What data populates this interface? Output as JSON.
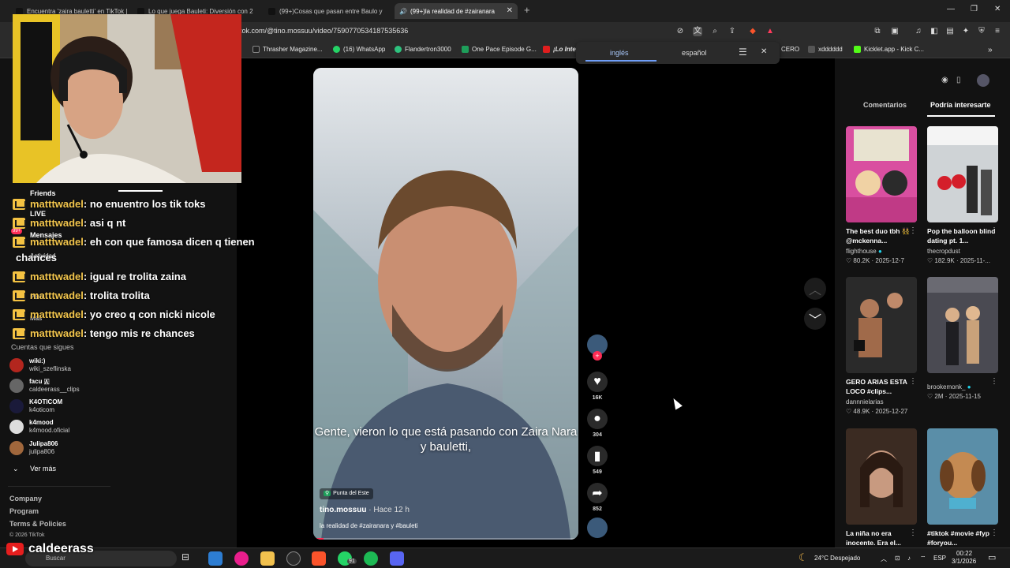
{
  "browser": {
    "tabs": [
      {
        "label": "Encuentra 'zaira bauletti' en TikTok |"
      },
      {
        "label": "Lo que juega Bauleti: Diversión con 2"
      },
      {
        "label": "(99+)Cosas que pasan entre Baulo y"
      },
      {
        "label": "(99+)la realidad de #zairanara"
      }
    ],
    "url": "tok.com/@tino.mossuu/video/7590770534187535636",
    "bookmarks": [
      {
        "label": "Thrasher Magazine...",
        "color": "#222"
      },
      {
        "label": "(16) WhatsApp",
        "color": "#25d366"
      },
      {
        "label": "Flandertron3000",
        "color": "#2ec27e"
      },
      {
        "label": "One Pace Episode G...",
        "color": "#1e9e5a"
      },
      {
        "label": "¡Lo Inte",
        "color": "#e01e1e"
      },
      {
        "label": "CERO",
        "color": "#444"
      },
      {
        "label": "xdddddd",
        "color": "#555"
      },
      {
        "label": "Kicklet.app - Kick C...",
        "color": "#53fc18"
      }
    ],
    "translate": {
      "source": "inglés",
      "target": "español"
    }
  },
  "sidebar": {
    "nav": {
      "friends": "Friends",
      "live": "LIVE",
      "messages": "Mensajes",
      "messages_badge": "99+",
      "activity": "Actividad",
      "profile": "Perfil",
      "more": "Más"
    },
    "following_title": "Cuentas que sigues",
    "following": [
      {
        "name": "wiki:)",
        "handle": "wiki_szeflinska",
        "color": "#b3261e"
      },
      {
        "name": "facu 🇦",
        "handle": "caldeerass__clips",
        "color": "#666"
      },
      {
        "name": "K4OTICOM",
        "handle": "k4oticom",
        "color": "#1a1a3a"
      },
      {
        "name": "k4mood",
        "handle": "k4mood.oficial",
        "color": "#ddd"
      },
      {
        "name": "Julipa806",
        "handle": "julipa806",
        "color": "#a0673c"
      }
    ],
    "see_more": "Ver más",
    "footer": [
      "Company",
      "Program",
      "Terms & Policies"
    ],
    "copyright": "© 2026 TikTok"
  },
  "chat": [
    {
      "user": "matttwadel",
      "text": ": no enuentro los tik toks"
    },
    {
      "user": "matttwadel",
      "text": ": asi q nt"
    },
    {
      "user": "matttwadel",
      "text": ": eh con que famosa dicen q tienen"
    },
    {
      "user": "",
      "text": "chances"
    },
    {
      "user": "matttwadel",
      "text": ": igual re trolita zaina"
    },
    {
      "user": "matttwadel",
      "text": ": trolita trolita"
    },
    {
      "user": "matttwadel",
      "text": ": yo creo q con nicki nicole"
    },
    {
      "user": "matttwadel",
      "text": ": tengo mis re chances"
    }
  ],
  "video": {
    "caption": "Gente, vieron lo que está pasando con Zaira Nara y bauletti,",
    "location": "Punta del Este",
    "author": "tino.mossuu",
    "time_ago": "· Hace 12 h",
    "description": "la realidad de #zairanara y #bauleti",
    "likes": "16K",
    "comments": "304",
    "saves": "549",
    "shares": "852"
  },
  "right_panel": {
    "tabs": {
      "comments": "Comentarios",
      "suggested": "Podría interesarte"
    },
    "cards": [
      {
        "title": "The best duo tbh 👯 @mckenna...",
        "user": "flighthouse",
        "likes": "80.2K",
        "date": "2025-12-7",
        "thumb": "#d94fa0"
      },
      {
        "title": "Pop the balloon blind dating pt. 1...",
        "user": "thecropdust",
        "likes": "182.9K",
        "date": "2025-11-...",
        "thumb": "#cfd3d6"
      },
      {
        "title": "GERO ARIAS ESTA LOCO #clips...",
        "user": "dannnielarias",
        "likes": "48.9K",
        "date": "2025-12-27",
        "thumb": "#2a2a2a"
      },
      {
        "title": "",
        "user": "brookemonk_",
        "likes": "2M",
        "date": "2025-11-15",
        "thumb": "#4a4a52"
      },
      {
        "title": "La niña no era inocente. Era el...",
        "user": "",
        "likes": "",
        "date": "",
        "thumb": "#3b2b22"
      },
      {
        "title": "#tiktok #movie #fyp #foryou...",
        "user": "",
        "likes": "",
        "date": "",
        "thumb": "#5a8ea8"
      }
    ]
  },
  "taskbar": {
    "search": "Buscar",
    "weather": "24°C Despejado",
    "lang": "ESP",
    "time": "00:22",
    "date": "3/1/2026",
    "whatsapp_badge": "91"
  },
  "stream": {
    "channel": "caldeerass"
  }
}
